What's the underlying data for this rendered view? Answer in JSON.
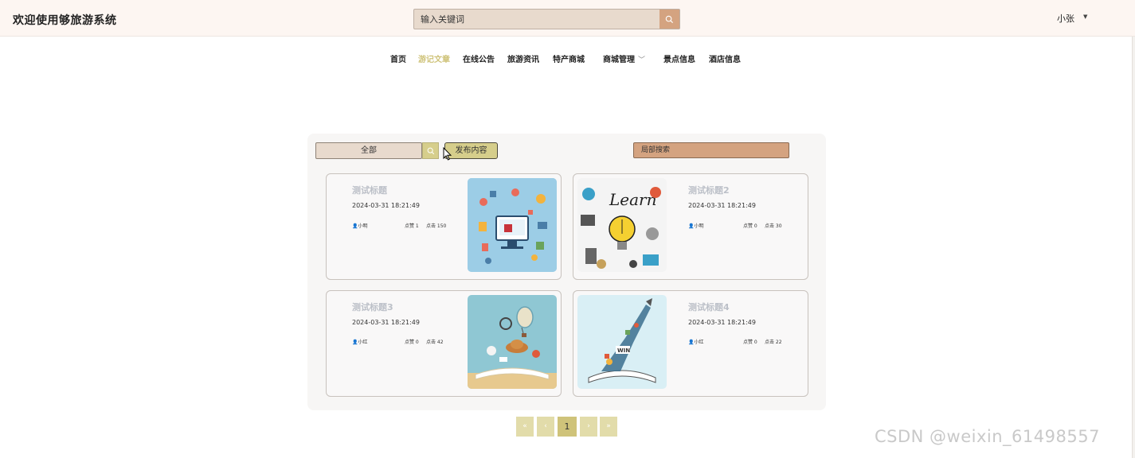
{
  "header": {
    "title": "欢迎使用够旅游系统",
    "search_placeholder": "输入关键词",
    "user": "小张"
  },
  "nav": [
    {
      "label": "首页",
      "active": false
    },
    {
      "label": "游记文章",
      "active": true
    },
    {
      "label": "在线公告",
      "active": false
    },
    {
      "label": "旅游资讯",
      "active": false
    },
    {
      "label": "特产商城",
      "active": false
    },
    {
      "label": "商城管理",
      "active": false,
      "dropdown": true
    },
    {
      "label": "景点信息",
      "active": false
    },
    {
      "label": "酒店信息",
      "active": false
    }
  ],
  "toolbar": {
    "filter": "全部",
    "publish": "发布内容",
    "local_search": "局部搜索"
  },
  "articles": [
    {
      "title": "测试标题",
      "date": "2024-03-31 18:21:49",
      "author": "小明",
      "likes": "点赞 1",
      "clicks": "点击 150",
      "image": "computer-shopping-illustration"
    },
    {
      "title": "测试标题2",
      "date": "2024-03-31 18:21:49",
      "author": "小明",
      "likes": "点赞 0",
      "clicks": "点击 30",
      "image": "learn-lightbulb-illustration"
    },
    {
      "title": "测试标题3",
      "date": "2024-03-31 18:21:49",
      "author": "小红",
      "likes": "点赞 0",
      "clicks": "点击 42",
      "image": "open-book-travel-illustration"
    },
    {
      "title": "测试标题4",
      "date": "2024-03-31 18:21:49",
      "author": "小红",
      "likes": "点赞 0",
      "clicks": "点击 22",
      "image": "book-rocket-illustration"
    }
  ],
  "pagination": {
    "first": "«",
    "prev": "‹",
    "current": "1",
    "next": "›",
    "last": "»"
  },
  "watermark": "CSDN @weixin_61498557",
  "colors": {
    "topbar_bg": "#fdf6f2",
    "accent_tan": "#d4a380",
    "accent_olive": "#cfc37a",
    "beige": "#e8dacd"
  }
}
